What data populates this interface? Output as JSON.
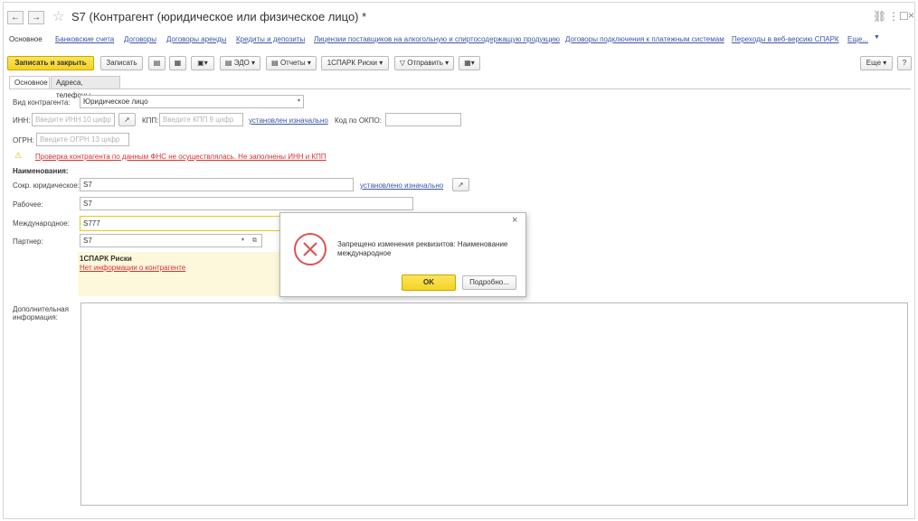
{
  "window": {
    "back_label": "←",
    "forward_label": "→",
    "title": "S7 (Контрагент (юридическое или физическое лицо) *",
    "link_glyph": "⛓",
    "menu_glyph": "⋮",
    "restore_glyph": "☐",
    "close_glyph": "×"
  },
  "nav_links": {
    "active": "Основное",
    "items": [
      "Банковские счета",
      "Договоры",
      "Договоры аренды",
      "Кредиты и депозиты",
      "Лицензии поставщиков на алкогольную и спиртосодержащую продукцию",
      "Договоры подключения к платежным системам",
      "Переходы в веб-версию СПАРК",
      "Еще..."
    ]
  },
  "toolbar": {
    "save_close": "Записать и закрыть",
    "save": "Записать",
    "edo": "ЭДО",
    "reports": "Отчеты",
    "spark": "1СПАРК Риски",
    "send": "Отправить",
    "more": "Еще",
    "help": "?"
  },
  "tabs": [
    "Основное",
    "Адреса, телефоны"
  ],
  "form": {
    "kind_label": "Вид контрагента:",
    "kind_value": "Юридическое лицо",
    "inn_label": "ИНН:",
    "inn_placeholder": "Введите ИНН 10 цифр",
    "kpp_label": "КПП:",
    "kpp_placeholder": "Введите КПП 9 цифр",
    "set_initially_link": "установлен изначально",
    "okpo_label": "Код по ОКПО:",
    "okpo_value": "",
    "ogrn_label": "ОГРН:",
    "ogrn_placeholder": "Введите ОГРН 13 цифр",
    "warning_text": "Проверка контрагента по данным ФНС не осуществлялась. Не заполнены ИНН и КПП",
    "names_header": "Наименования:",
    "short_label": "Сокр. юридическое:",
    "short_value": "S7",
    "short_link": "установлено изначально",
    "working_label": "Рабочее:",
    "working_value": "S7",
    "intl_label": "Международное:",
    "intl_value": "S777",
    "partner_label": "Партнер:",
    "partner_value": "S7",
    "spark_title": "1СПАРК Риски",
    "spark_link": "Нет информации о контрагенте",
    "addinfo_label_1": "Дополнительная",
    "addinfo_label_2": "информация:",
    "addinfo_value": ""
  },
  "dialog": {
    "message": "Запрещено изменения реквизитов: Наименование международное",
    "ok": "OK",
    "details": "Подробно...",
    "close_glyph": "×"
  },
  "colors": {
    "accent_yellow": "#f5d226",
    "link_blue": "#3a56a8",
    "error_red": "#e05050"
  }
}
